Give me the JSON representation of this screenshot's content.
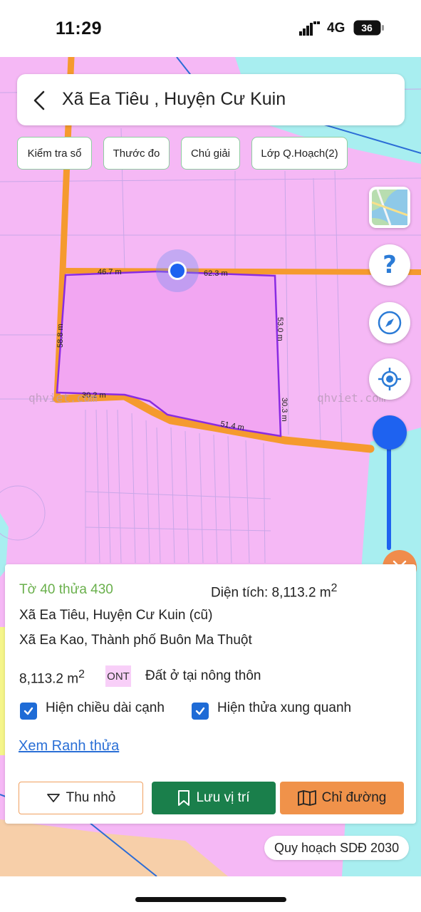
{
  "status_bar": {
    "time": "11:29",
    "network": "4G",
    "battery": "36"
  },
  "header": {
    "title": "Xã Ea Tiêu , Huyện Cư Kuin"
  },
  "toolbar": {
    "check_book": "Kiểm tra sổ",
    "ruler": "Thước đo",
    "legend": "Chú giải",
    "planning_layers": "Lớp Q.Hoạch(2)"
  },
  "map": {
    "edge_labels": [
      "46.7 m",
      "62.3 m",
      "58.8 m",
      "53.0 m",
      "30.2 m",
      "30.3 m",
      "51.4 m"
    ],
    "watermark": "qhviet.com",
    "colors": {
      "residential": "#f5b8f5",
      "road": "#f59a2e",
      "water": "#a8eef0",
      "parcel_border": "#8a2be2",
      "location": "#1e62f0"
    },
    "zoom_level": 0.9
  },
  "controls": {
    "help": "?"
  },
  "panel": {
    "parcel": "Tờ 40 thửa 430",
    "area_label": "Diện tích: 8,113.2 m",
    "area_sup": "2",
    "address_old": "Xã Ea Tiêu, Huyện Cư Kuin (cũ)",
    "address_new": "Xã Ea Kao, Thành phố Buôn Ma Thuột",
    "area_value": "8,113.2 m",
    "area_value_sup": "2",
    "land_code": "ONT",
    "land_type": "Đất ở tại nông thôn",
    "show_edge_lengths": "Hiện chiều dài cạnh",
    "show_neighbors": "Hiện thửa xung quanh",
    "view_boundary": "Xem Ranh thửa",
    "collapse": "Thu nhỏ",
    "save_location": "Lưu vị trí",
    "directions": "Chỉ đường"
  },
  "plan_label": "Quy hoạch SDĐ 2030"
}
